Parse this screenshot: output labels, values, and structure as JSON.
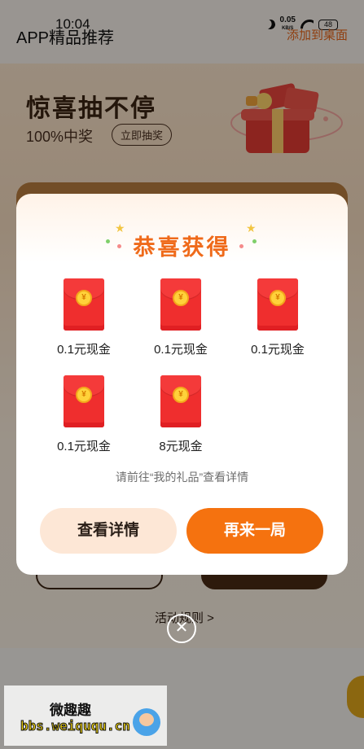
{
  "status_bar": {
    "time": "10:04",
    "net_speed_value": "0.05",
    "net_speed_unit": "KB/S",
    "battery": "48"
  },
  "app_bar": {
    "title": "APP精品推荐",
    "add_to_desktop": "添加到桌面"
  },
  "hero": {
    "title": "惊喜抽不停",
    "subtitle": "100%中奖",
    "draw_button": "立即抽奖"
  },
  "background_links": {
    "rules": "活动规则 >"
  },
  "dialog": {
    "title": "恭喜获得",
    "prizes": [
      {
        "label": "0.1元现金",
        "coin": "¥"
      },
      {
        "label": "0.1元现金",
        "coin": "¥"
      },
      {
        "label": "0.1元现金",
        "coin": "¥"
      },
      {
        "label": "0.1元现金",
        "coin": "¥"
      },
      {
        "label": "8元现金",
        "coin": "¥"
      }
    ],
    "hint": "请前往“我的礼品”查看详情",
    "view_details_button": "查看详情",
    "play_again_button": "再来一局",
    "close_icon": "✕"
  },
  "watermark": {
    "title": "微趣趣",
    "url": "bbs.weiququ.cn"
  },
  "colors": {
    "accent": "#f5720f",
    "title_orange": "#ef6a1a",
    "envelope_red": "#ef2e2e"
  }
}
